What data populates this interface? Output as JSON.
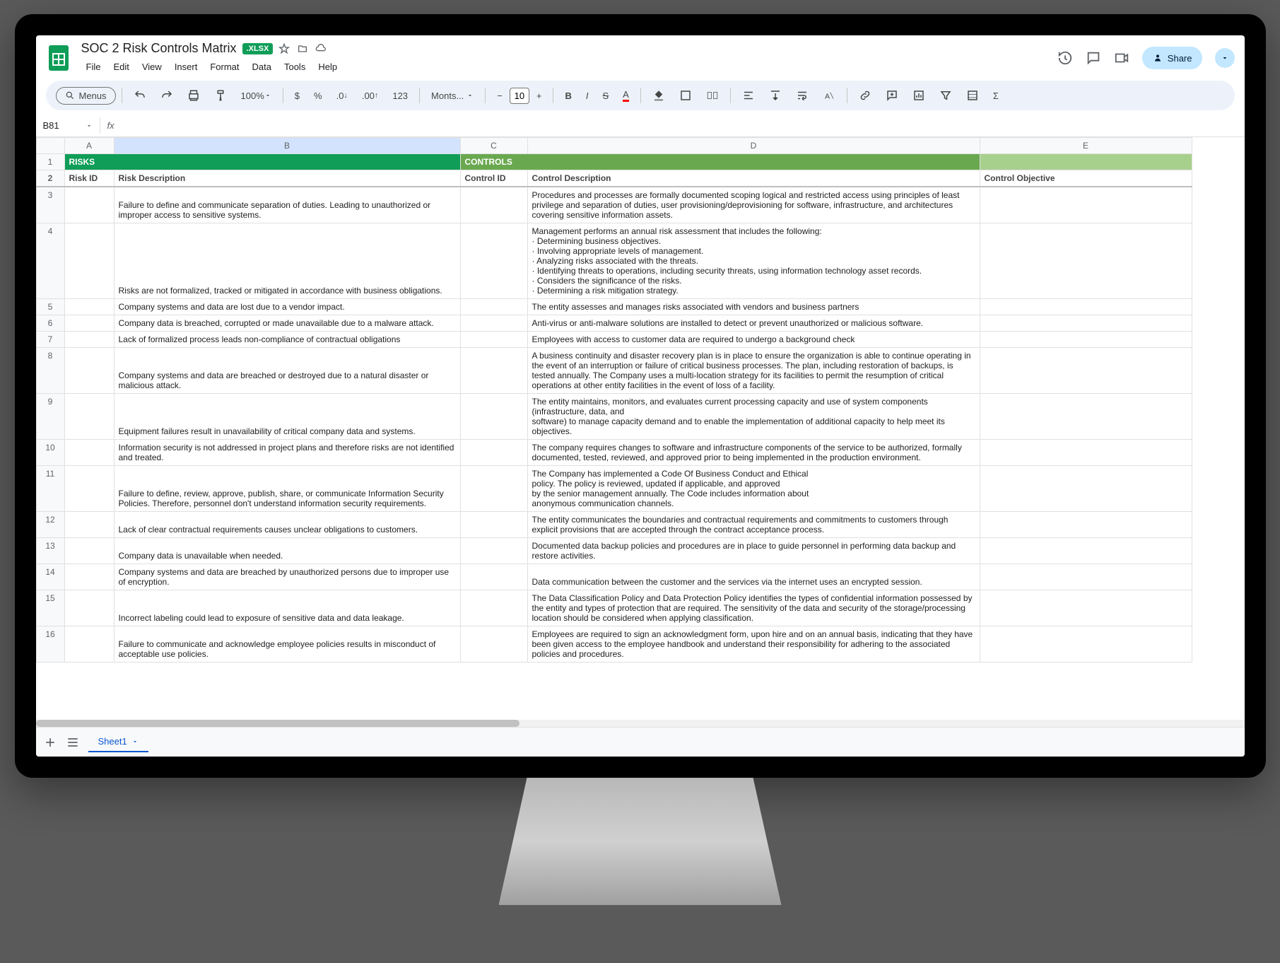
{
  "doc": {
    "title": "SOC 2 Risk Controls Matrix",
    "badge": ".XLSX",
    "menus": [
      "File",
      "Edit",
      "View",
      "Insert",
      "Format",
      "Data",
      "Tools",
      "Help"
    ],
    "share": "Share"
  },
  "toolbar": {
    "menus_label": "Menus",
    "zoom": "100%",
    "font_name": "Monts...",
    "font_size": "10",
    "currency": "$",
    "percent": "%",
    "dec_dec": ".0",
    "inc_dec": ".00",
    "numfmt": "123"
  },
  "namebox": "B81",
  "columns": [
    "A",
    "B",
    "C",
    "D",
    "E"
  ],
  "section_headers": {
    "risks": "RISKS",
    "controls": "CONTROLS"
  },
  "subheaders": {
    "a": "Risk ID",
    "b": "Risk Description",
    "c": "Control ID",
    "d": "Control Description",
    "e": "Control Objective"
  },
  "rows": [
    {
      "n": "3",
      "b": "Failure to define and communicate separation of duties. Leading to unauthorized or improper access to sensitive systems.",
      "d": "Procedures and processes are formally documented scoping logical and restricted access using principles of least privilege and separation of duties, user provisioning/deprovisioning for software, infrastructure, and architectures covering sensitive information assets."
    },
    {
      "n": "4",
      "b": "Risks are not formalized, tracked or mitigated in accordance with business obligations.",
      "d": "Management performs an annual risk assessment that includes the following:\n· Determining business objectives.\n· Involving appropriate levels of management.\n· Analyzing risks associated with the threats.\n· Identifying threats to operations, including security threats, using information technology asset records.\n· Considers the significance of the risks.\n· Determining a risk mitigation strategy."
    },
    {
      "n": "5",
      "b": "Company systems and data are lost due to a vendor impact.",
      "d": "The entity assesses and manages risks associated with vendors and business partners"
    },
    {
      "n": "6",
      "b": "Company data is breached, corrupted or made unavailable due to a malware attack.",
      "d": "Anti-virus or anti-malware solutions are installed to detect or prevent unauthorized or malicious software."
    },
    {
      "n": "7",
      "b": "Lack of formalized process leads non-compliance of contractual obligations",
      "d": "Employees with access to customer data are required to undergo a background check"
    },
    {
      "n": "8",
      "b": "Company systems and data are breached or destroyed due to a natural disaster or malicious attack.",
      "d": "A business continuity and disaster recovery plan is in place to ensure the organization is able to continue operating in the event of an interruption or failure of critical business processes. The plan, including restoration of backups, is tested annually. The Company uses a multi-location strategy for its facilities to permit the resumption of critical operations at other entity facilities in the event of loss of a facility."
    },
    {
      "n": "9",
      "b": "Equipment failures result in unavailability of critical company data and systems.",
      "d": "The entity maintains, monitors, and evaluates current processing capacity and use of system components (infrastructure, data, and\nsoftware) to manage capacity demand and to enable the implementation of additional capacity to help meet its objectives."
    },
    {
      "n": "10",
      "b": "Information security is not addressed in project plans and therefore risks are not identified and treated.",
      "d": "The company requires changes to software and infrastructure components of the service to be authorized, formally documented, tested, reviewed, and approved prior to being implemented in the production environment."
    },
    {
      "n": "11",
      "b": "Failure to define, review, approve, publish, share, or communicate Information Security Policies. Therefore, personnel don't understand information security requirements.",
      "d": "The Company has implemented a Code Of Business Conduct and Ethical\npolicy. The policy is reviewed, updated if applicable, and approved\nby the senior management annually. The Code includes information about\nanonymous communication channels."
    },
    {
      "n": "12",
      "b": "Lack of clear contractual requirements causes unclear obligations to customers.",
      "d": "The entity communicates the boundaries and contractual requirements and commitments to customers through explicit provisions that are accepted through the contract acceptance process."
    },
    {
      "n": "13",
      "b": "Company data is unavailable when needed.",
      "d": "Documented data backup policies and procedures are in place to guide personnel in performing data backup and restore activities."
    },
    {
      "n": "14",
      "b": "Company systems and data are breached by unauthorized persons due to improper use of encryption.",
      "d": "Data communication between the customer and the services via the internet uses an encrypted session."
    },
    {
      "n": "15",
      "b": "Incorrect labeling could lead to exposure of sensitive data and data leakage.",
      "d": "The Data Classification Policy and Data Protection Policy identifies the types of confidential information possessed by the entity and types of protection that are required. The sensitivity of the data and security of the storage/processing location should be considered when applying classification."
    },
    {
      "n": "16",
      "b": "Failure to communicate and acknowledge employee policies results in misconduct of acceptable use policies.",
      "d": "Employees are required to sign an acknowledgment form, upon hire and on an annual basis, indicating that they have been given access to the employee handbook and understand their responsibility for adhering to the associated policies and procedures."
    }
  ],
  "sheet_tab": "Sheet1"
}
